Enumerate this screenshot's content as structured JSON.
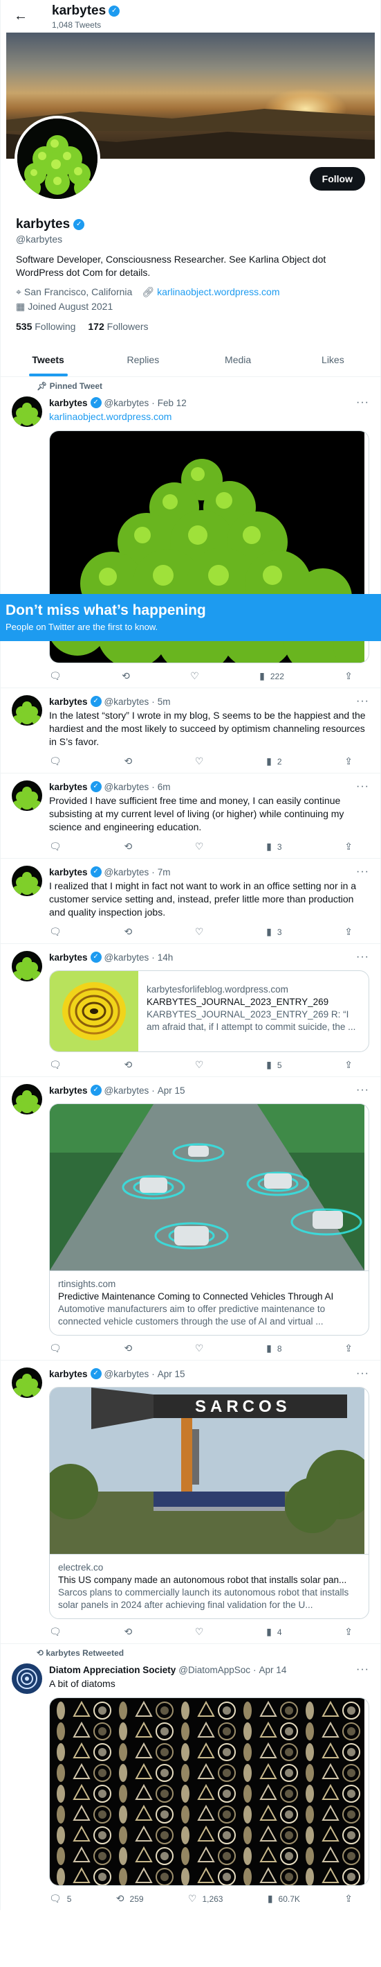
{
  "header": {
    "name": "karbytes",
    "tweet_count": "1,048 Tweets"
  },
  "profile": {
    "name": "karbytes",
    "handle": "@karbytes",
    "follow_label": "Follow",
    "bio": "Software Developer, Consciousness Researcher. See Karlina Object dot WordPress dot Com for details.",
    "location": "San Francisco, California",
    "website": "karlinaobject.wordpress.com",
    "joined": "Joined August 2021",
    "following_count": "535",
    "following_label": "Following",
    "followers_count": "172",
    "followers_label": "Followers"
  },
  "tabs": [
    "Tweets",
    "Replies",
    "Media",
    "Likes"
  ],
  "promo": {
    "title": "Don’t miss what’s happening",
    "subtitle": "People on Twitter are the first to know."
  },
  "tweets": [
    {
      "context": "Pinned Tweet",
      "name": "karbytes",
      "handle": "@karbytes",
      "time": "Feb 12",
      "text": "karlinaobject.wordpress.com",
      "views": "222"
    },
    {
      "name": "karbytes",
      "handle": "@karbytes",
      "time": "5m",
      "text": "In the latest “story” I wrote in my blog, S seems to be the happiest and the hardiest and the most likely to succeed by optimism channeling resources in S’s favor.",
      "views": "2"
    },
    {
      "name": "karbytes",
      "handle": "@karbytes",
      "time": "6m",
      "text": "Provided I have sufficient free time and money, I can easily continue subsisting at my current level of living (or higher) while continuing my science and engineering education.",
      "views": "3"
    },
    {
      "name": "karbytes",
      "handle": "@karbytes",
      "time": "7m",
      "text": "I realized that I might in fact not want to work in an office setting nor in a customer service setting and, instead, prefer little more than production and quality inspection jobs.",
      "views": "3"
    },
    {
      "name": "karbytes",
      "handle": "@karbytes",
      "time": "14h",
      "card_domain": "karbytesforlifeblog.wordpress.com",
      "card_title": "KARBYTES_JOURNAL_2023_ENTRY_269",
      "card_desc": "KARBYTES_JOURNAL_2023_ENTRY_269 R: “I am afraid that, if I attempt to commit suicide, the ...",
      "views": "5"
    },
    {
      "name": "karbytes",
      "handle": "@karbytes",
      "time": "Apr 15",
      "card_domain": "rtinsights.com",
      "card_title": "Predictive Maintenance Coming to Connected Vehicles Through AI",
      "card_desc": "Automotive manufacturers aim to offer predictive maintenance to connected vehicle customers through the use of AI and virtual ...",
      "views": "8"
    },
    {
      "name": "karbytes",
      "handle": "@karbytes",
      "time": "Apr 15",
      "card_domain": "electrek.co",
      "card_title": "This US company made an autonomous robot that installs solar pan...",
      "card_desc": "Sarcos plans to commercially launch its autonomous robot that installs solar panels in 2024 after achieving final validation for the U...",
      "image_text": "SARCOS",
      "views": "4"
    },
    {
      "context": "karbytes Retweeted",
      "name": "Diatom Appreciation Society",
      "handle": "@DiatomAppSoc",
      "time": "Apr 14",
      "text": "A bit of diatoms",
      "replies": "5",
      "retweets": "259",
      "likes": "1,263",
      "views": "60.7K"
    }
  ]
}
